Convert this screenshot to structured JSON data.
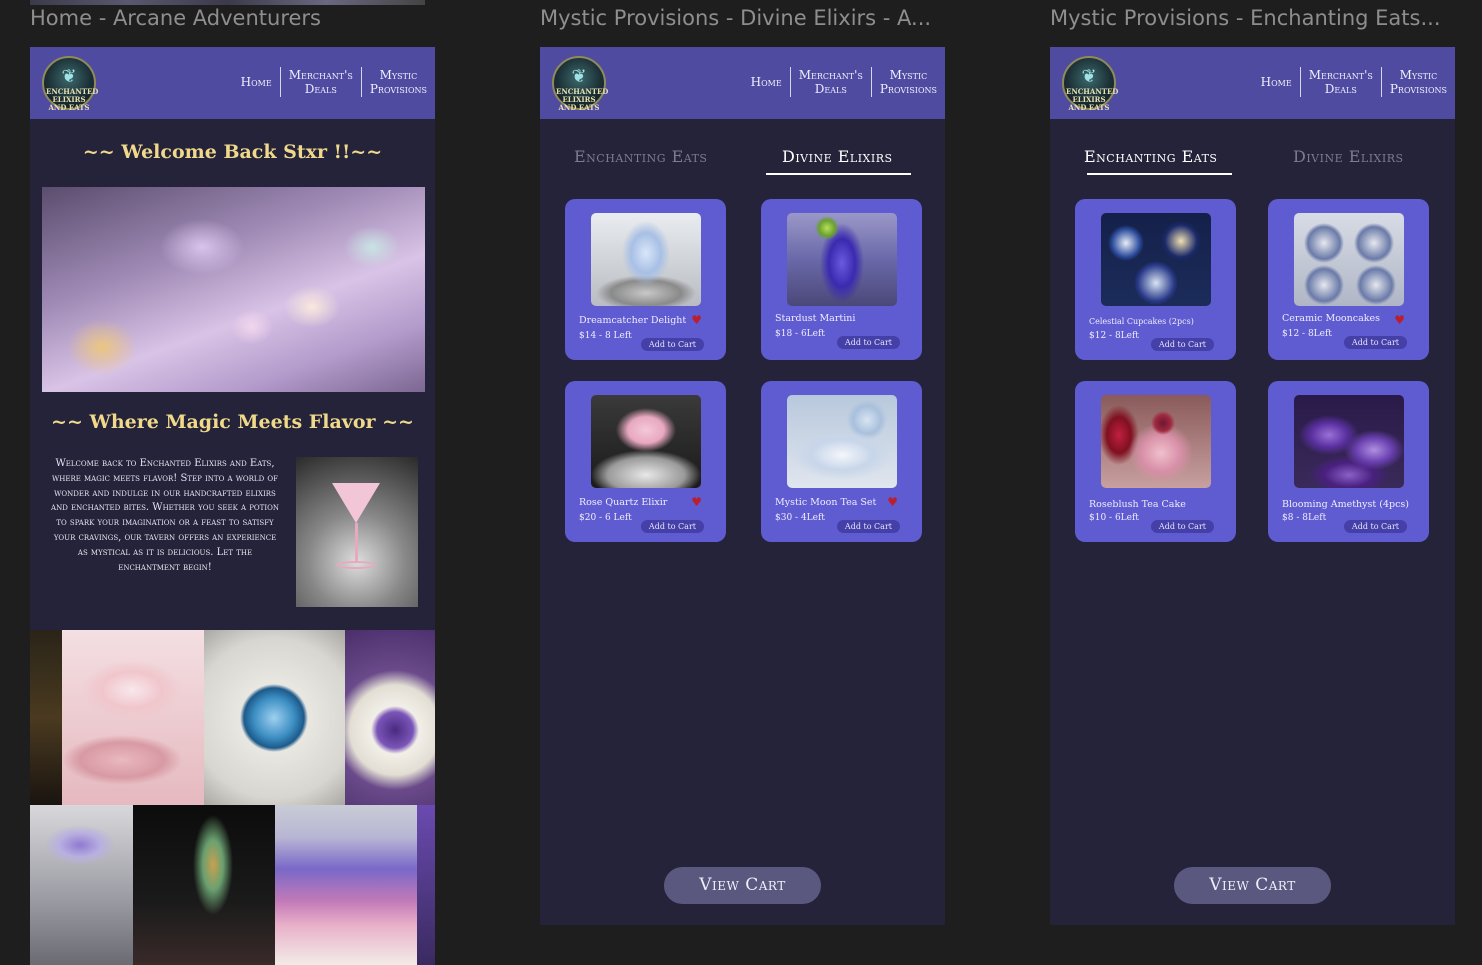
{
  "frames": {
    "home": {
      "label": "Home - Arcane Adventurers"
    },
    "elixirs": {
      "label": "Mystic Provisions - Divine Elixirs - A..."
    },
    "eats": {
      "label": "Mystic Provisions - Enchanting Eats..."
    }
  },
  "logo": {
    "text": "ENCHANTED ELIXIRS AND EATS"
  },
  "nav": {
    "home": "Home",
    "deals_line1": "Merchant's",
    "deals_line2": "Deals",
    "provisions_line1": "Mystic",
    "provisions_line2": "Provisions"
  },
  "home": {
    "welcome": "~~ Welcome Back Stxr !!~~",
    "tagline": "~~ Where Magic Meets Flavor ~~",
    "intro": "Welcome back to Enchanted Elixirs and Eats, where magic meets flavor! Step into a world of wonder and indulge in our handcrafted elixirs and enchanted bites. Whether you seek a potion to spark your imagination or a feast to satisfy your cravings, our tavern offers an experience as mystical as it is delicious. Let the enchantment begin!"
  },
  "tabs": {
    "eats": "Enchanting Eats",
    "elixirs": "Divine Elixirs"
  },
  "add_to_cart": "Add to Cart",
  "view_cart": "View Cart",
  "elixirs": [
    {
      "name": "Dreamcatcher Delight",
      "price": "$14  -  8 Left",
      "favorite": true
    },
    {
      "name": "Stardust Martini",
      "price": "$18  -  6Left",
      "favorite": false
    },
    {
      "name": "Rose Quartz Elixir",
      "price": "$20  -  6 Left",
      "favorite": true
    },
    {
      "name": "Mystic Moon Tea Set",
      "price": "$30  -  4Left",
      "favorite": true
    }
  ],
  "eats": [
    {
      "name": "Celestial Cupcakes (2pcs)",
      "price": "$12  -  8Left",
      "favorite": false
    },
    {
      "name": "Ceramic Mooncakes",
      "price": "$12  -  8Left",
      "favorite": true
    },
    {
      "name": "Roseblush Tea Cake",
      "price": "$10  -  6Left",
      "favorite": false
    },
    {
      "name": "Blooming Amethyst (4pcs)",
      "price": "$8  -  8Left",
      "favorite": false
    }
  ],
  "colors": {
    "header": "#4e4ba0",
    "frame_bg": "#25233a",
    "card": "#5f5bd0",
    "gold_heading": "#f0d98a",
    "heart": "#b82030",
    "view_cart_button": "#5b5880"
  }
}
